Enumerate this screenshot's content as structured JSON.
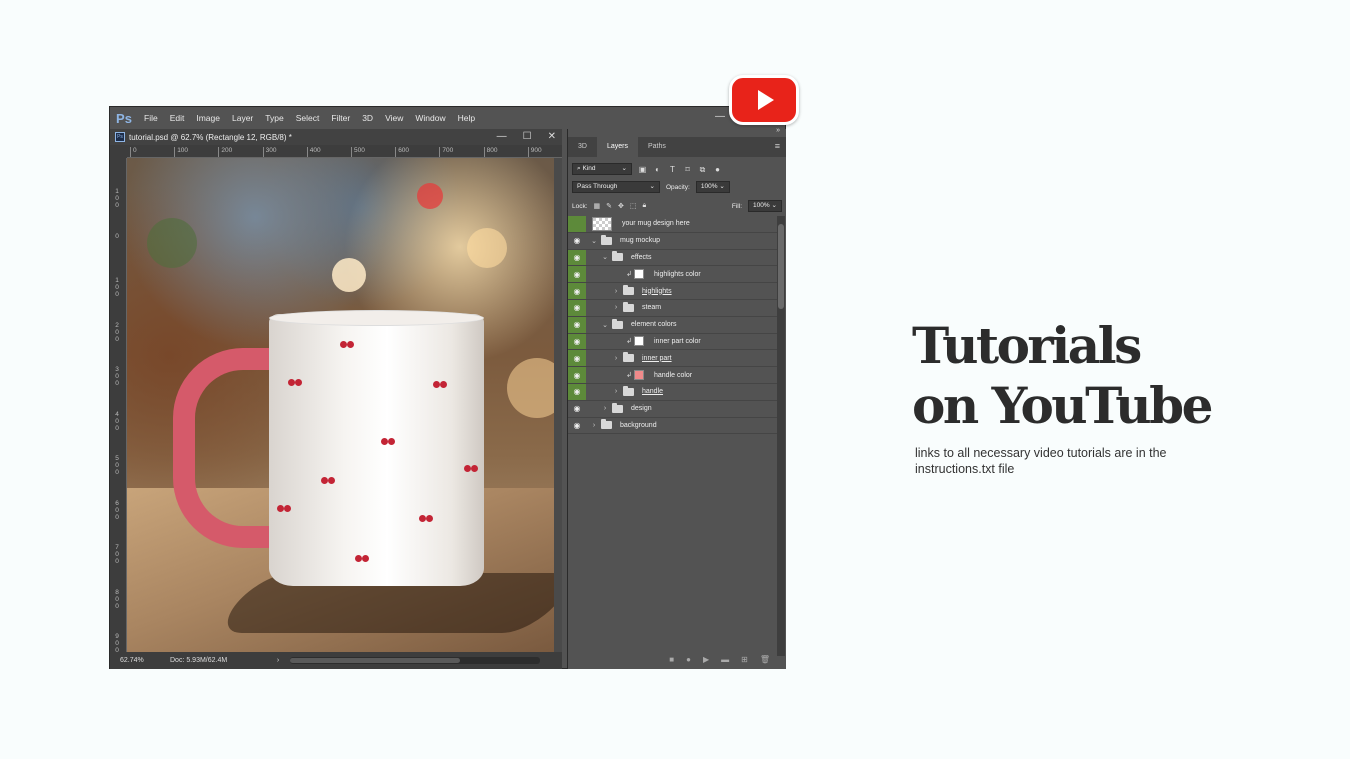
{
  "photoshop": {
    "logo": "Ps",
    "menu": [
      "File",
      "Edit",
      "Image",
      "Layer",
      "Type",
      "Select",
      "Filter",
      "3D",
      "View",
      "Window",
      "Help"
    ],
    "document_tab": "tutorial.psd @ 62.7% (Rectangle 12, RGB/8) *",
    "ruler_top": [
      "0",
      "100",
      "200",
      "300",
      "400",
      "500",
      "600",
      "700",
      "800",
      "900"
    ],
    "ruler_left": [
      "1 0 0",
      "0",
      "1 0 0",
      "2 0 0",
      "3 0 0",
      "4 0 0",
      "5 0 0",
      "6 0 0",
      "7 0 0",
      "8 0 0",
      "9 0 0"
    ],
    "status": {
      "zoom": "62.74%",
      "doc": "Doc: 5.93M/62.4M",
      "arrow": "›"
    },
    "panel": {
      "tabs": [
        "3D",
        "Layers",
        "Paths"
      ],
      "active_tab": "Layers",
      "kind_label": "Kind",
      "blend_mode": "Pass Through",
      "opacity_label": "Opacity:",
      "opacity_value": "100%",
      "lock_label": "Lock:",
      "fill_label": "Fill:",
      "fill_value": "100%",
      "layers": [
        {
          "name": "your mug design here",
          "type": "smart-object",
          "eye": "green-noeye",
          "indent": 0
        },
        {
          "name": "mug mockup",
          "type": "group-open",
          "eye": "plain",
          "indent": 0
        },
        {
          "name": "effects",
          "type": "group-open",
          "eye": "green",
          "indent": 1
        },
        {
          "name": "highlights color",
          "type": "fill",
          "color": "#ffffff",
          "eye": "green",
          "indent": 2
        },
        {
          "name": "highlights",
          "type": "group-closed",
          "eye": "green",
          "indent": 2,
          "underlined": true
        },
        {
          "name": "steam",
          "type": "group-closed",
          "eye": "green",
          "indent": 2
        },
        {
          "name": "element colors",
          "type": "group-open",
          "eye": "green",
          "indent": 1
        },
        {
          "name": "inner part color",
          "type": "fill",
          "color": "#ffffff",
          "eye": "green",
          "indent": 2
        },
        {
          "name": "inner part",
          "type": "group-closed",
          "eye": "green",
          "indent": 2,
          "underlined": true
        },
        {
          "name": "handle color",
          "type": "fill",
          "color": "#f08a8a",
          "eye": "green",
          "indent": 2
        },
        {
          "name": "handle",
          "type": "group-closed",
          "eye": "green",
          "indent": 2,
          "underlined": true
        },
        {
          "name": "design",
          "type": "group-closed",
          "eye": "plain",
          "indent": 1
        },
        {
          "name": "background",
          "type": "group-closed",
          "eye": "plain",
          "indent": 0
        }
      ]
    }
  },
  "headline": {
    "line1": "Tutorials",
    "line2": "on YouTube"
  },
  "subtext": "links to all necessary video tutorials are in the instructions.txt file",
  "colors": {
    "youtube_red": "#e8231a",
    "visibility_green": "#5d8a3a"
  }
}
